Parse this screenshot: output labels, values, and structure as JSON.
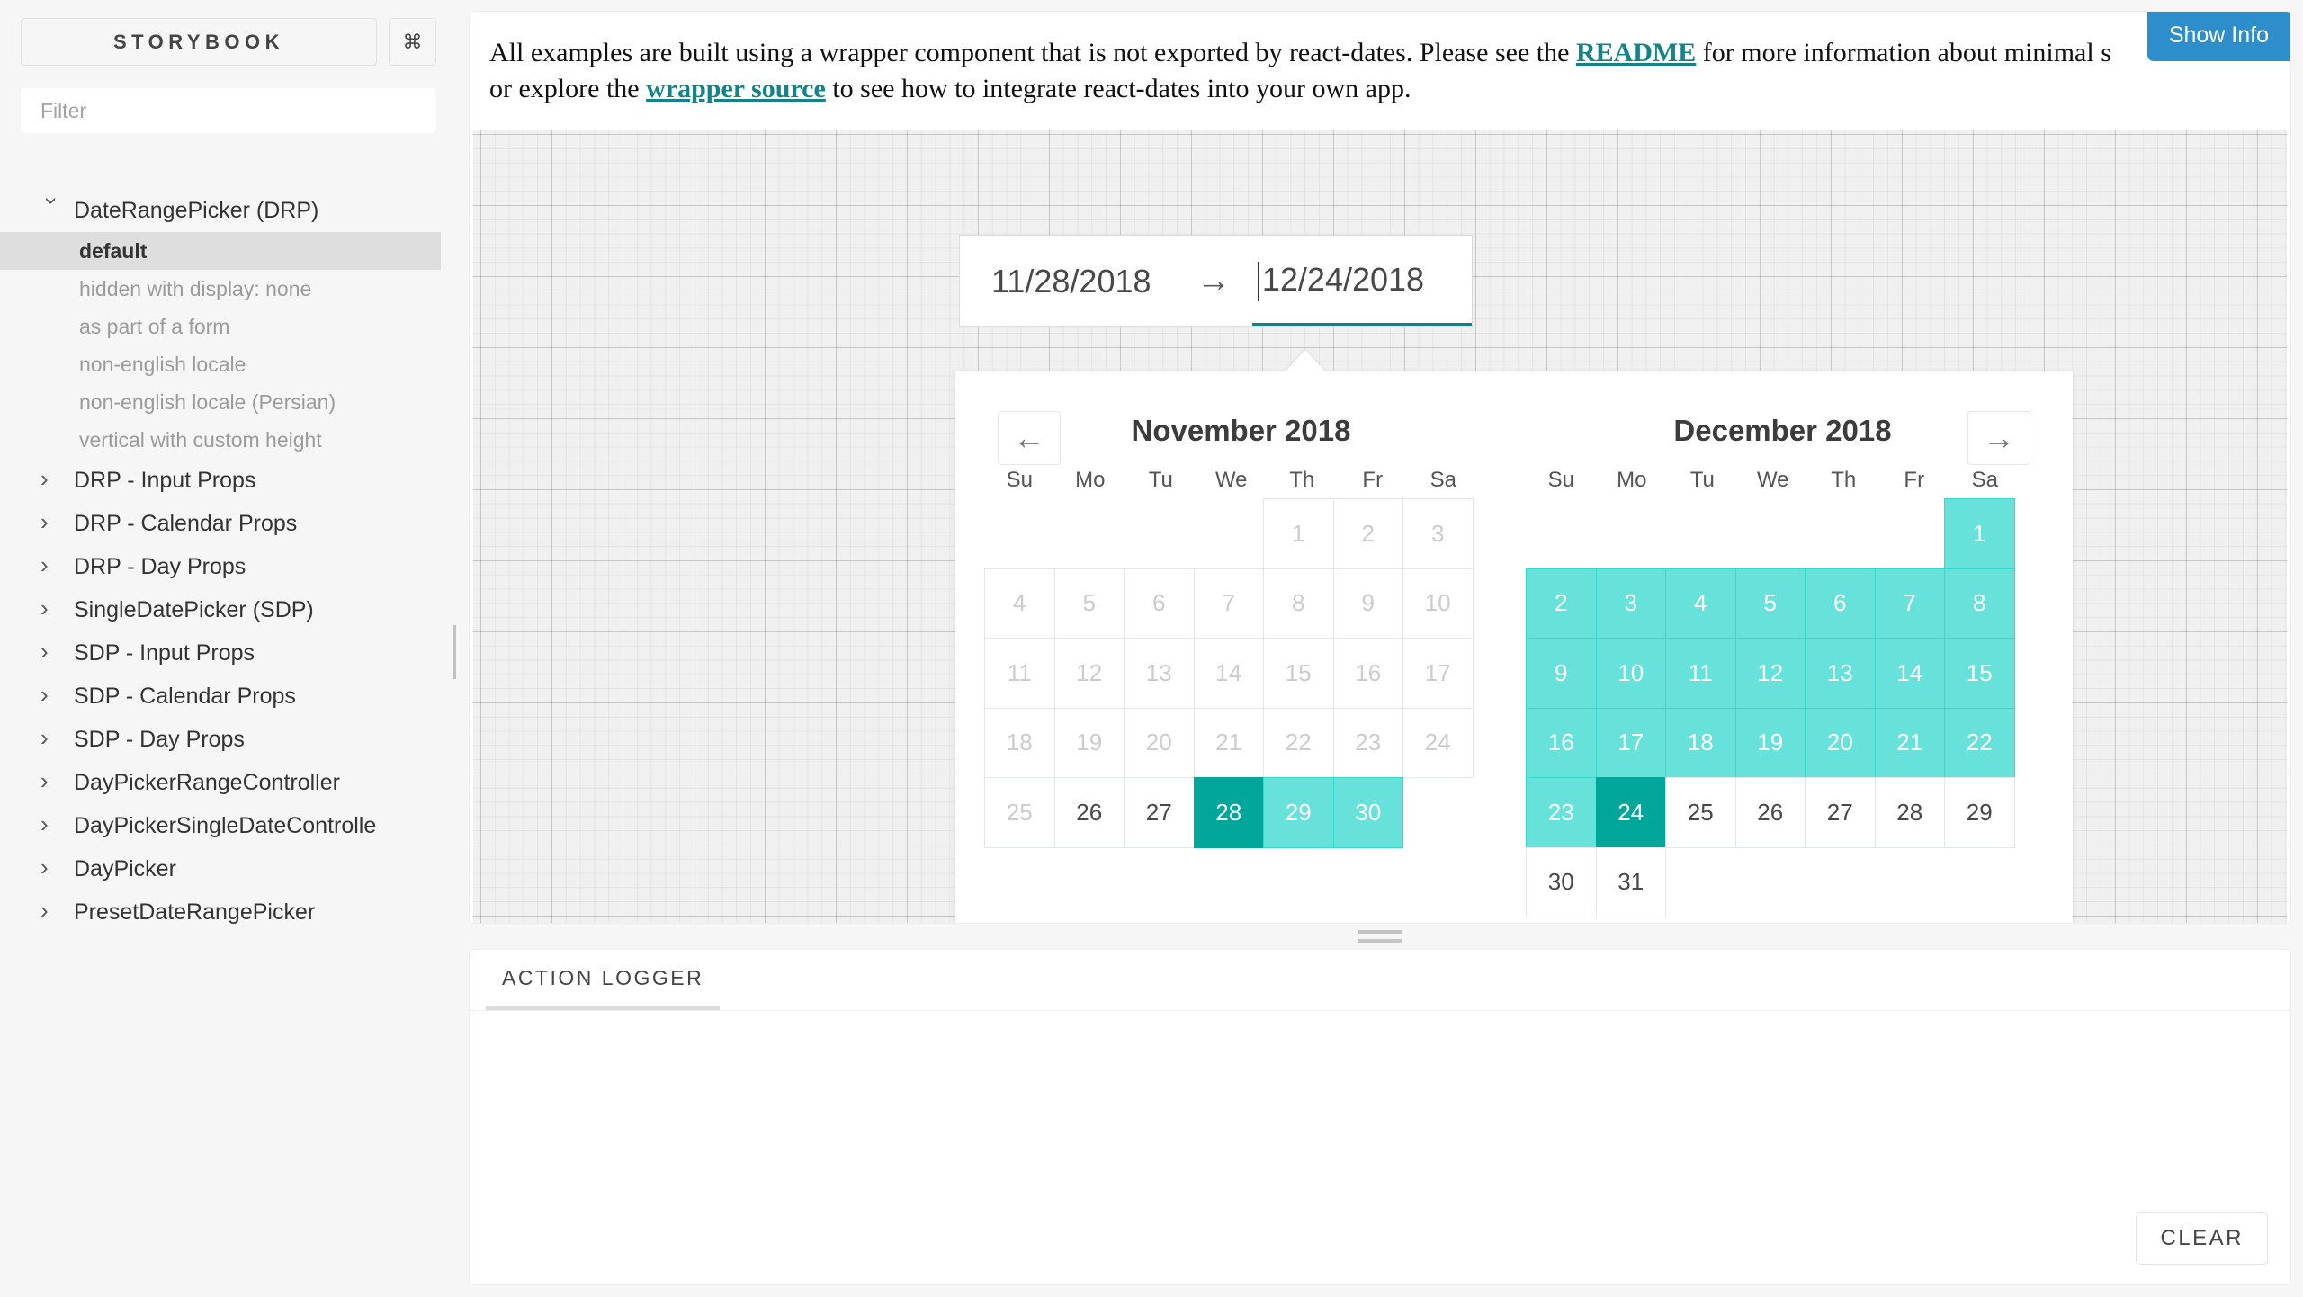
{
  "sidebar": {
    "brand": "STORYBOOK",
    "shortcut_icon": "⌘",
    "filter_placeholder": "Filter",
    "groups": [
      {
        "label": "DateRangePicker (DRP)",
        "open": true,
        "stories": [
          "default",
          "hidden with display: none",
          "as part of a form",
          "non-english locale",
          "non-english locale (Persian)",
          "vertical with custom height"
        ],
        "active_story": "default"
      },
      {
        "label": "DRP - Input Props",
        "open": false,
        "stories": []
      },
      {
        "label": "DRP - Calendar Props",
        "open": false,
        "stories": []
      },
      {
        "label": "DRP - Day Props",
        "open": false,
        "stories": []
      },
      {
        "label": "SingleDatePicker (SDP)",
        "open": false,
        "stories": []
      },
      {
        "label": "SDP - Input Props",
        "open": false,
        "stories": []
      },
      {
        "label": "SDP - Calendar Props",
        "open": false,
        "stories": []
      },
      {
        "label": "SDP - Day Props",
        "open": false,
        "stories": []
      },
      {
        "label": "DayPickerRangeController",
        "open": false,
        "stories": []
      },
      {
        "label": "DayPickerSingleDateControlle",
        "open": false,
        "stories": []
      },
      {
        "label": "DayPicker",
        "open": false,
        "stories": []
      },
      {
        "label": "PresetDateRangePicker",
        "open": false,
        "stories": []
      }
    ]
  },
  "note": {
    "part1": "All examples are built using a wrapper component that is not exported by react-dates. Please see the ",
    "link1": "README",
    "part2": " for more information about minimal s",
    "part3": "or explore the ",
    "link2": "wrapper source",
    "part4": " to see how to integrate react-dates into your own app.",
    "show_info_label": "Show Info",
    "link_color": "#13838a",
    "show_info_color": "#2e8ecb"
  },
  "daterangepicker": {
    "start_date": "11/28/2018",
    "arrow_icon": "→",
    "end_date": "12/24/2018",
    "focused_input": "end_date",
    "focus_underline_color": "#177e88",
    "prev_icon": "←",
    "next_icon": "→",
    "keyboard_shortcuts_icon": "?",
    "selected_color": "#00a699",
    "in_range_color": "#66e2da",
    "day_of_week": [
      "Su",
      "Mo",
      "Tu",
      "We",
      "Th",
      "Fr",
      "Sa"
    ],
    "months": [
      {
        "title": "November 2018",
        "weeks": [
          [
            {
              "label": "",
              "state": "empty"
            },
            {
              "label": "",
              "state": "empty"
            },
            {
              "label": "",
              "state": "empty"
            },
            {
              "label": "",
              "state": "empty"
            },
            {
              "label": "1",
              "state": "blocked"
            },
            {
              "label": "2",
              "state": "blocked"
            },
            {
              "label": "3",
              "state": "blocked"
            }
          ],
          [
            {
              "label": "4",
              "state": "blocked"
            },
            {
              "label": "5",
              "state": "blocked"
            },
            {
              "label": "6",
              "state": "blocked"
            },
            {
              "label": "7",
              "state": "blocked"
            },
            {
              "label": "8",
              "state": "blocked"
            },
            {
              "label": "9",
              "state": "blocked"
            },
            {
              "label": "10",
              "state": "blocked"
            }
          ],
          [
            {
              "label": "11",
              "state": "blocked"
            },
            {
              "label": "12",
              "state": "blocked"
            },
            {
              "label": "13",
              "state": "blocked"
            },
            {
              "label": "14",
              "state": "blocked"
            },
            {
              "label": "15",
              "state": "blocked"
            },
            {
              "label": "16",
              "state": "blocked"
            },
            {
              "label": "17",
              "state": "blocked"
            }
          ],
          [
            {
              "label": "18",
              "state": "blocked"
            },
            {
              "label": "19",
              "state": "blocked"
            },
            {
              "label": "20",
              "state": "blocked"
            },
            {
              "label": "21",
              "state": "blocked"
            },
            {
              "label": "22",
              "state": "blocked"
            },
            {
              "label": "23",
              "state": "blocked"
            },
            {
              "label": "24",
              "state": "blocked"
            }
          ],
          [
            {
              "label": "25",
              "state": "blocked"
            },
            {
              "label": "26",
              "state": "default"
            },
            {
              "label": "27",
              "state": "default"
            },
            {
              "label": "28",
              "state": "selected"
            },
            {
              "label": "29",
              "state": "in-range"
            },
            {
              "label": "30",
              "state": "in-range"
            },
            {
              "label": "",
              "state": "empty"
            }
          ]
        ]
      },
      {
        "title": "December 2018",
        "weeks": [
          [
            {
              "label": "",
              "state": "empty"
            },
            {
              "label": "",
              "state": "empty"
            },
            {
              "label": "",
              "state": "empty"
            },
            {
              "label": "",
              "state": "empty"
            },
            {
              "label": "",
              "state": "empty"
            },
            {
              "label": "",
              "state": "empty"
            },
            {
              "label": "1",
              "state": "in-range"
            }
          ],
          [
            {
              "label": "2",
              "state": "in-range"
            },
            {
              "label": "3",
              "state": "in-range"
            },
            {
              "label": "4",
              "state": "in-range"
            },
            {
              "label": "5",
              "state": "in-range"
            },
            {
              "label": "6",
              "state": "in-range"
            },
            {
              "label": "7",
              "state": "in-range"
            },
            {
              "label": "8",
              "state": "in-range"
            }
          ],
          [
            {
              "label": "9",
              "state": "in-range"
            },
            {
              "label": "10",
              "state": "in-range"
            },
            {
              "label": "11",
              "state": "in-range"
            },
            {
              "label": "12",
              "state": "in-range"
            },
            {
              "label": "13",
              "state": "in-range"
            },
            {
              "label": "14",
              "state": "in-range"
            },
            {
              "label": "15",
              "state": "in-range"
            }
          ],
          [
            {
              "label": "16",
              "state": "in-range"
            },
            {
              "label": "17",
              "state": "in-range"
            },
            {
              "label": "18",
              "state": "in-range"
            },
            {
              "label": "19",
              "state": "in-range"
            },
            {
              "label": "20",
              "state": "in-range"
            },
            {
              "label": "21",
              "state": "in-range"
            },
            {
              "label": "22",
              "state": "in-range"
            }
          ],
          [
            {
              "label": "23",
              "state": "in-range"
            },
            {
              "label": "24",
              "state": "selected"
            },
            {
              "label": "25",
              "state": "default"
            },
            {
              "label": "26",
              "state": "default"
            },
            {
              "label": "27",
              "state": "default"
            },
            {
              "label": "28",
              "state": "default"
            },
            {
              "label": "29",
              "state": "default"
            }
          ],
          [
            {
              "label": "30",
              "state": "default"
            },
            {
              "label": "31",
              "state": "default"
            },
            {
              "label": "",
              "state": "empty"
            },
            {
              "label": "",
              "state": "empty"
            },
            {
              "label": "",
              "state": "empty"
            },
            {
              "label": "",
              "state": "empty"
            },
            {
              "label": "",
              "state": "empty"
            }
          ]
        ]
      }
    ]
  },
  "panel": {
    "tabs": [
      {
        "label": "ACTION LOGGER",
        "active": true
      }
    ],
    "clear_label": "CLEAR",
    "log_entries": []
  }
}
